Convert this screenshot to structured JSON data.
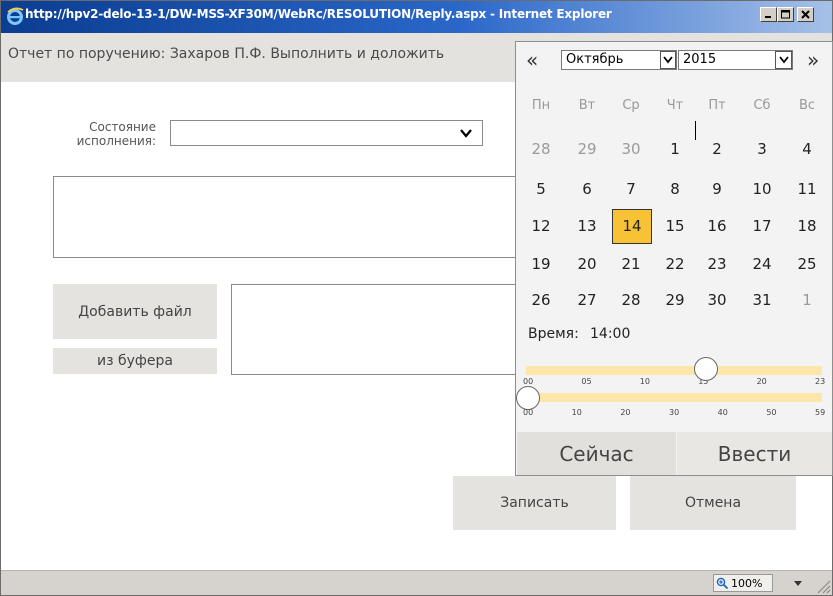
{
  "window": {
    "title": "http://hpv2-delo-13-1/DW-MSS-XF30M/WebRc/RESOLUTION/Reply.aspx - Internet Explorer",
    "buttons": {
      "minimize_icon": "minimize-icon",
      "maximize_icon": "maximize-icon",
      "close_icon": "close-icon"
    }
  },
  "header": {
    "text": "Отчет по поручению: Захаров П.Ф. Выполнить и доложить"
  },
  "form": {
    "state_label": "Состояние исполнения:",
    "state_value": "",
    "text_value": "",
    "add_file_label": "Добавить файл",
    "buffer_label": "из буфера",
    "save_label": "Записать",
    "cancel_label": "Отмена"
  },
  "status_bar": {
    "zoom": "100%"
  },
  "calendar": {
    "prev_label": "«",
    "next_label": "»",
    "month": "Октябрь",
    "year": "2015",
    "weekdays": [
      "Пн",
      "Вт",
      "Ср",
      "Чт",
      "Пт",
      "Сб",
      "Вс"
    ],
    "weeks": [
      [
        {
          "d": "28",
          "o": true
        },
        {
          "d": "29",
          "o": true
        },
        {
          "d": "30",
          "o": true
        },
        {
          "d": "1"
        },
        {
          "d": "2"
        },
        {
          "d": "3"
        },
        {
          "d": "4"
        }
      ],
      [
        {
          "d": "5"
        },
        {
          "d": "6"
        },
        {
          "d": "7"
        },
        {
          "d": "8"
        },
        {
          "d": "9"
        },
        {
          "d": "10"
        },
        {
          "d": "11"
        }
      ],
      [
        {
          "d": "12"
        },
        {
          "d": "13"
        },
        {
          "d": "14",
          "sel": true
        },
        {
          "d": "15"
        },
        {
          "d": "16"
        },
        {
          "d": "17"
        },
        {
          "d": "18"
        }
      ],
      [
        {
          "d": "19"
        },
        {
          "d": "20"
        },
        {
          "d": "21"
        },
        {
          "d": "22"
        },
        {
          "d": "23"
        },
        {
          "d": "24"
        },
        {
          "d": "25"
        }
      ],
      [
        {
          "d": "26"
        },
        {
          "d": "27"
        },
        {
          "d": "28"
        },
        {
          "d": "29"
        },
        {
          "d": "30"
        },
        {
          "d": "31"
        },
        {
          "d": "1",
          "o": true
        }
      ]
    ],
    "time_label": "Время:",
    "time_value": "14:00",
    "hour_ticks": [
      "00",
      "05",
      "10",
      "15",
      "20",
      "23"
    ],
    "minute_ticks": [
      "00",
      "10",
      "20",
      "30",
      "40",
      "50",
      "59"
    ],
    "hour_value": 14,
    "minute_value": 0,
    "now_label": "Сейчас",
    "enter_label": "Ввести",
    "accent_color": "#f8c235"
  }
}
